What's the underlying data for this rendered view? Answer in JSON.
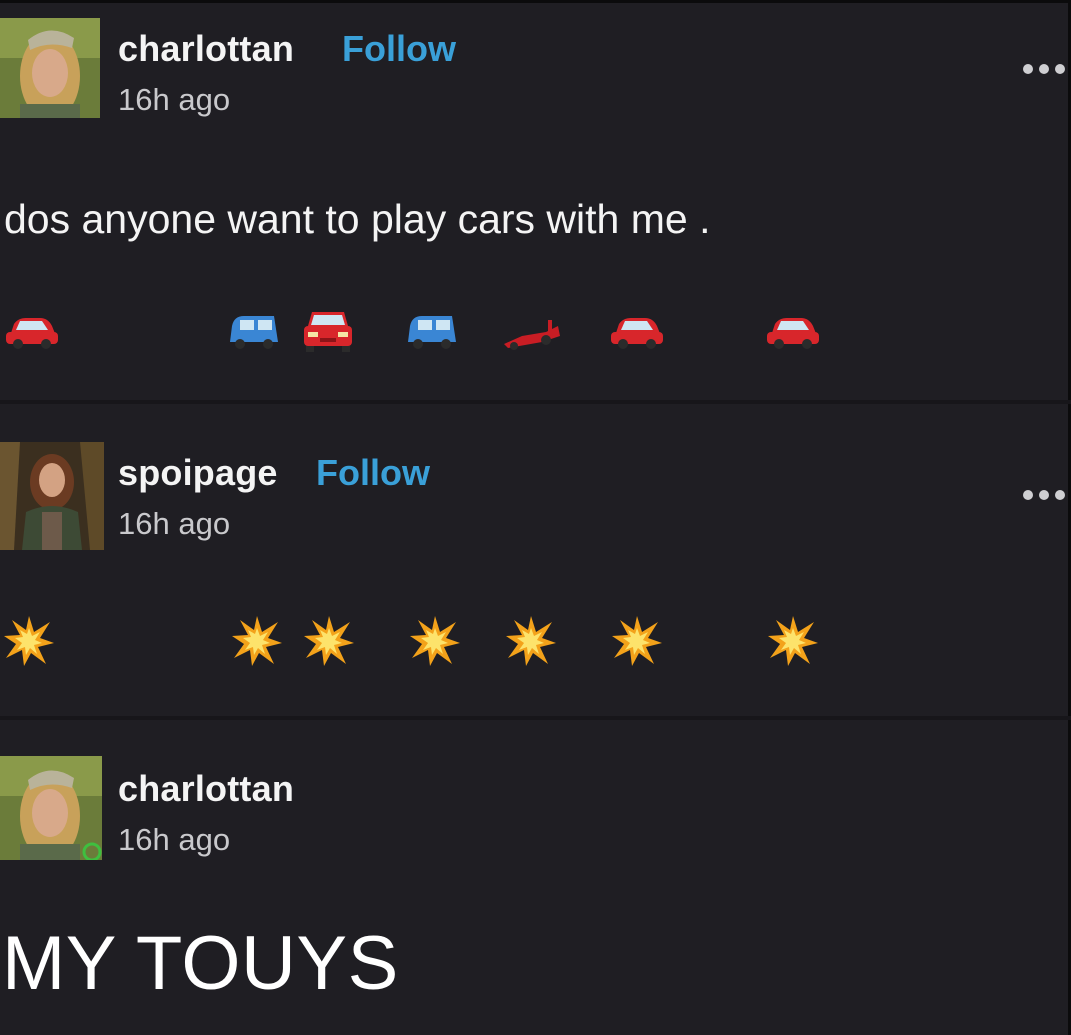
{
  "posts": [
    {
      "username": "charlottan",
      "follow_label": "Follow",
      "time": "16h ago",
      "text": "dos anyone want to play cars with me .",
      "emoji_row": [
        "red-car",
        "blue-suv",
        "red-car-front",
        "blue-suv",
        "race-car",
        "red-car",
        "red-car"
      ]
    },
    {
      "username": "spoipage",
      "follow_label": "Follow",
      "time": "16h ago",
      "emoji_row": [
        "collision",
        "collision",
        "collision",
        "collision",
        "collision",
        "collision",
        "collision"
      ]
    },
    {
      "username": "charlottan",
      "time": "16h ago",
      "text": "MY TOUYS"
    }
  ],
  "colors": {
    "background": "#1f1e23",
    "follow": "#3aa0d8",
    "username": "#f4f4f4",
    "time": "#c9c9cc"
  }
}
